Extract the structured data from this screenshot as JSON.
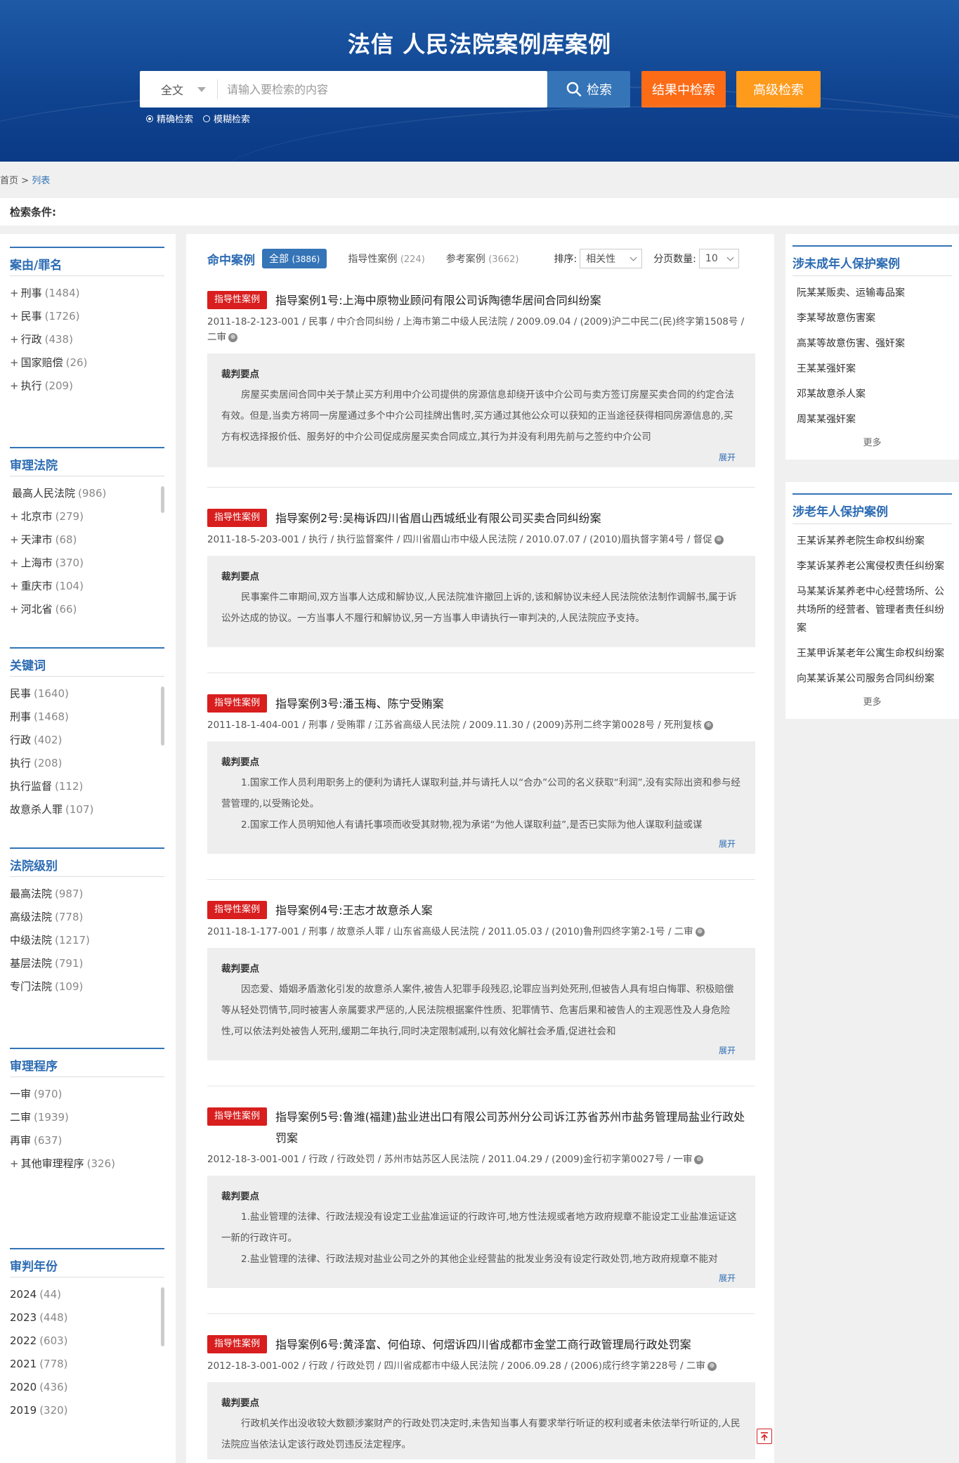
{
  "header": {
    "title": "法信 人民法院案例库案例",
    "scope": "全文",
    "search_placeholder": "请输入要检索的内容",
    "search_label": "检索",
    "refine_label": "结果中检索",
    "advanced_label": "高级检索",
    "exact_label": "精确检索",
    "fuzzy_label": "模糊检索"
  },
  "breadcrumb": {
    "home": "首页",
    "sep": ">",
    "current": "列表"
  },
  "conditions_label": "检索条件:",
  "facets": [
    {
      "title": "案由/罪名",
      "items": [
        {
          "prefix": "+",
          "label": "刑事",
          "count": "(1484)"
        },
        {
          "prefix": "+",
          "label": "民事",
          "count": "(1726)"
        },
        {
          "prefix": "+",
          "label": "行政",
          "count": "(438)"
        },
        {
          "prefix": "+",
          "label": "国家赔偿",
          "count": "(26)"
        },
        {
          "prefix": "+",
          "label": "执行",
          "count": "(209)"
        }
      ]
    },
    {
      "title": "审理法院",
      "items": [
        {
          "prefix": "",
          "label": "最高人民法院",
          "count": "(986)"
        },
        {
          "prefix": "+",
          "label": "北京市",
          "count": "(279)"
        },
        {
          "prefix": "+",
          "label": "天津市",
          "count": "(68)"
        },
        {
          "prefix": "+",
          "label": "上海市",
          "count": "(370)"
        },
        {
          "prefix": "+",
          "label": "重庆市",
          "count": "(104)"
        },
        {
          "prefix": "+",
          "label": "河北省",
          "count": "(66)"
        }
      ]
    },
    {
      "title": "关键词",
      "items": [
        {
          "prefix": "",
          "label": "民事",
          "count": "(1640)"
        },
        {
          "prefix": "",
          "label": "刑事",
          "count": "(1468)"
        },
        {
          "prefix": "",
          "label": "行政",
          "count": "(402)"
        },
        {
          "prefix": "",
          "label": "执行",
          "count": "(208)"
        },
        {
          "prefix": "",
          "label": "执行监督",
          "count": "(112)"
        },
        {
          "prefix": "",
          "label": "故意杀人罪",
          "count": "(107)"
        }
      ]
    },
    {
      "title": "法院级别",
      "items": [
        {
          "prefix": "",
          "label": "最高法院",
          "count": "(987)"
        },
        {
          "prefix": "",
          "label": "高级法院",
          "count": "(778)"
        },
        {
          "prefix": "",
          "label": "中级法院",
          "count": "(1217)"
        },
        {
          "prefix": "",
          "label": "基层法院",
          "count": "(791)"
        },
        {
          "prefix": "",
          "label": "专门法院",
          "count": "(109)"
        }
      ]
    },
    {
      "title": "审理程序",
      "items": [
        {
          "prefix": "",
          "label": "一审",
          "count": "(970)"
        },
        {
          "prefix": "",
          "label": "二审",
          "count": "(1939)"
        },
        {
          "prefix": "",
          "label": "再审",
          "count": "(637)"
        },
        {
          "prefix": "+",
          "label": "其他审理程序",
          "count": "(326)"
        }
      ]
    },
    {
      "title": "审判年份",
      "items": [
        {
          "prefix": "",
          "label": "2024",
          "count": "(44)"
        },
        {
          "prefix": "",
          "label": "2023",
          "count": "(448)"
        },
        {
          "prefix": "",
          "label": "2022",
          "count": "(603)"
        },
        {
          "prefix": "",
          "label": "2021",
          "count": "(778)"
        },
        {
          "prefix": "",
          "label": "2020",
          "count": "(436)"
        },
        {
          "prefix": "",
          "label": "2019",
          "count": "(320)"
        }
      ]
    }
  ],
  "results": {
    "label": "命中案例",
    "tab_all": "全部",
    "tab_all_count": "(3886)",
    "tab_guiding": "指导性案例",
    "tab_guiding_count": "(224)",
    "tab_reference": "参考案例",
    "tab_reference_count": "(3662)",
    "sort_label": "排序:",
    "sort_value": "相关性",
    "page_size_label": "分页数量:",
    "page_size_value": "10"
  },
  "cases": [
    {
      "badge": "指导性案例",
      "title": "指导案例1号:上海中原物业顾问有限公司诉陶德华居间合同纠纷案",
      "meta": "2011-18-2-123-001 / 民事 / 中介合同纠纷 / 上海市第二中级人民法院 / 2009.09.04 / (2009)沪二中民二(民)终字第1508号 / 二审",
      "box_title": "裁判要点",
      "paras": [
        "房屋买卖居间合同中关于禁止买方利用中介公司提供的房源信息却绕开该中介公司与卖方签订房屋买卖合同的约定合法有效。但是,当卖方将同一房屋通过多个中介公司挂牌出售时,买方通过其他公众可以获知的正当途径获得相同房源信息的,买方有权选择报价低、服务好的中介公司促成房屋买卖合同成立,其行为并没有利用先前与之签约中介公司"
      ],
      "expand": "展开"
    },
    {
      "badge": "指导性案例",
      "title": "指导案例2号:吴梅诉四川省眉山西城纸业有限公司买卖合同纠纷案",
      "meta": "2011-18-5-203-001 / 执行 / 执行监督案件 / 四川省眉山市中级人民法院 / 2010.07.07 / (2010)眉执督字第4号 / 督促",
      "box_title": "裁判要点",
      "paras": [
        "民事案件二审期间,双方当事人达成和解协议,人民法院准许撤回上诉的,该和解协议未经人民法院依法制作调解书,属于诉讼外达成的协议。一方当事人不履行和解协议,另一方当事人申请执行一审判决的,人民法院应予支持。"
      ],
      "expand": ""
    },
    {
      "badge": "指导性案例",
      "title": "指导案例3号:潘玉梅、陈宁受贿案",
      "meta": "2011-18-1-404-001 / 刑事 / 受贿罪 / 江苏省高级人民法院 / 2009.11.30 / (2009)苏刑二终字第0028号 / 死刑复核",
      "box_title": "裁判要点",
      "paras": [
        "1.国家工作人员利用职务上的便利为请托人谋取利益,并与请托人以“合办”公司的名义获取“利润”,没有实际出资和参与经营管理的,以受贿论处。",
        "2.国家工作人员明知他人有请托事项而收受其财物,视为承诺“为他人谋取利益”,是否已实际为他人谋取利益或谋"
      ],
      "expand": "展开"
    },
    {
      "badge": "指导性案例",
      "title": "指导案例4号:王志才故意杀人案",
      "meta": "2011-18-1-177-001 / 刑事 / 故意杀人罪 / 山东省高级人民法院 / 2011.05.03 / (2010)鲁刑四终字第2-1号 / 二审",
      "box_title": "裁判要点",
      "paras": [
        "因恋爱、婚姻矛盾激化引发的故意杀人案件,被告人犯罪手段残忍,论罪应当判处死刑,但被告人具有坦白悔罪、积极赔偿等从轻处罚情节,同时被害人亲属要求严惩的,人民法院根据案件性质、犯罪情节、危害后果和被告人的主观恶性及人身危险性,可以依法判处被告人死刑,缓期二年执行,同时决定限制减刑,以有效化解社会矛盾,促进社会和"
      ],
      "expand": "展开"
    },
    {
      "badge": "指导性案例",
      "title": "指导案例5号:鲁潍(福建)盐业进出口有限公司苏州分公司诉江苏省苏州市盐务管理局盐业行政处罚案",
      "meta": "2012-18-3-001-001 / 行政 / 行政处罚 / 苏州市姑苏区人民法院 / 2011.04.29 / (2009)金行初字第0027号 / 一审",
      "box_title": "裁判要点",
      "paras": [
        "1.盐业管理的法律、行政法规没有设定工业盐准运证的行政许可,地方性法规或者地方政府规章不能设定工业盐准运证这一新的行政许可。",
        "2.盐业管理的法律、行政法规对盐业公司之外的其他企业经营盐的批发业务没有设定行政处罚,地方政府规章不能对"
      ],
      "expand": "展开"
    },
    {
      "badge": "指导性案例",
      "title": "指导案例6号:黄泽富、何伯琼、何熠诉四川省成都市金堂工商行政管理局行政处罚案",
      "meta": "2012-18-3-001-002 / 行政 / 行政处罚 / 四川省成都市中级人民法院 / 2006.09.28 / (2006)成行终字第228号 / 二审",
      "box_title": "裁判要点",
      "paras": [
        "行政机关作出没收较大数额涉案财产的行政处罚决定时,未告知当事人有要求举行听证的权利或者未依法举行听证的,人民法院应当依法认定该行政处罚违反法定程序。"
      ],
      "expand": ""
    }
  ],
  "right": [
    {
      "title": "涉未成年人保护案例",
      "items": [
        "阮某某贩卖、运输毒品案",
        "李某琴故意伤害案",
        "高某等故意伤害、强奸案",
        "王某某强奸案",
        "邓某故意杀人案",
        "周某某强奸案"
      ],
      "more": "更多"
    },
    {
      "title": "涉老年人保护案例",
      "items": [
        "王某诉某养老院生命权纠纷案",
        "李某诉某养老公寓侵权责任纠纷案",
        "马某某诉某养老中心经营场所、公共场所的经营者、管理者责任纠纷案",
        "王某甲诉某老年公寓生命权纠纷案",
        "向某某诉某公司服务合同纠纷案"
      ],
      "more": "更多"
    }
  ]
}
